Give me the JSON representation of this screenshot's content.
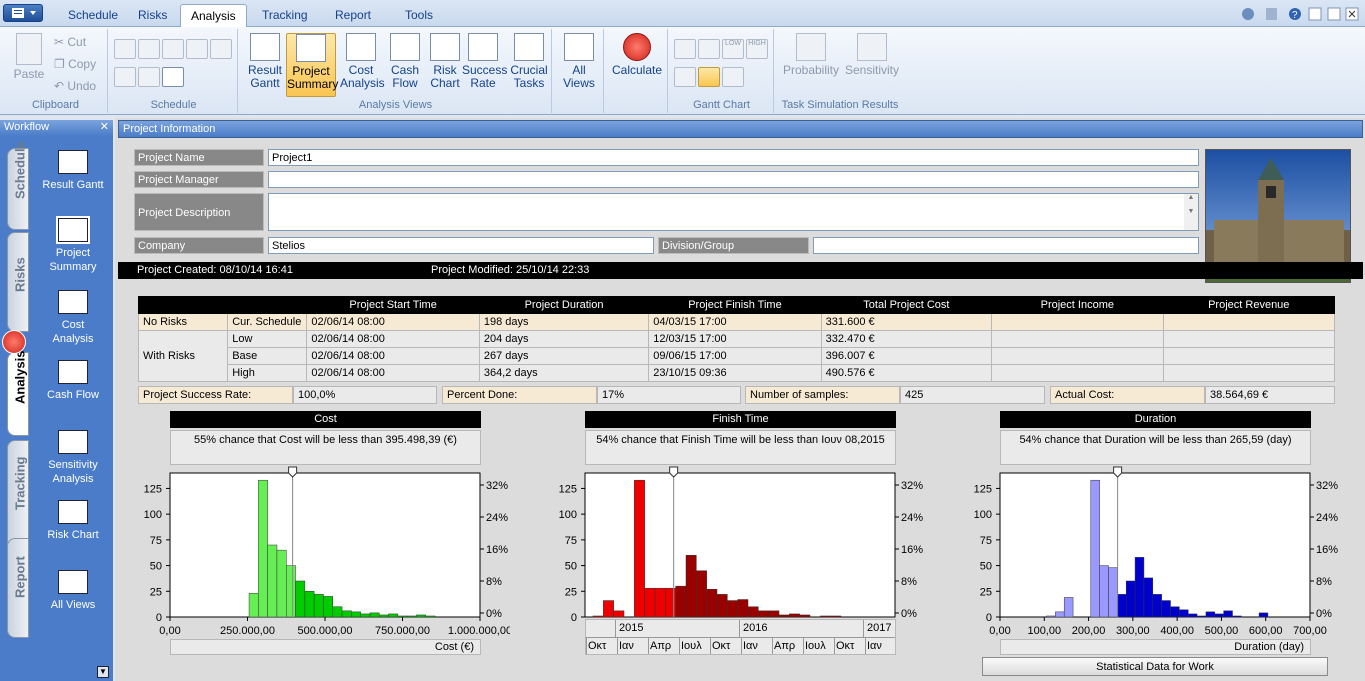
{
  "tabs": [
    {
      "label": "Schedule",
      "x": 58
    },
    {
      "label": "Risks",
      "x": 128
    },
    {
      "label": "Analysis",
      "x": 180,
      "active": true
    },
    {
      "label": "Tracking",
      "x": 252
    },
    {
      "label": "Report",
      "x": 325
    },
    {
      "label": "Tools",
      "x": 395
    }
  ],
  "ribbon": {
    "clipboard": {
      "paste": "Paste",
      "cut": "Cut",
      "copy": "Copy",
      "undo": "Undo",
      "label": "Clipboard"
    },
    "schedule_label": "Schedule",
    "analysis_views": {
      "label": "Analysis Views",
      "buttons": [
        {
          "l1": "Result",
          "l2": "Gantt"
        },
        {
          "l1": "Project",
          "l2": "Summary"
        },
        {
          "l1": "Cost",
          "l2": "Analysis"
        },
        {
          "l1": "Cash",
          "l2": "Flow"
        },
        {
          "l1": "Risk",
          "l2": "Chart"
        },
        {
          "l1": "Success",
          "l2": "Rate"
        },
        {
          "l1": "Crucial",
          "l2": "Tasks"
        }
      ]
    },
    "all_views": {
      "l1": "All",
      "l2": "Views"
    },
    "calculate": "Calculate",
    "gantt_chart_label": "Gantt Chart",
    "probability": "Probability",
    "sensitivity": "Sensitivity",
    "task_sim_label": "Task Simulation Results"
  },
  "workflow": {
    "title": "Workflow",
    "vtabs": [
      "Schedule",
      "Risks",
      "Analysis",
      "Tracking",
      "Report"
    ],
    "items": [
      {
        "l1": "Result Gantt",
        "l2": ""
      },
      {
        "l1": "Project",
        "l2": "Summary"
      },
      {
        "l1": "Cost",
        "l2": "Analysis"
      },
      {
        "l1": "Cash Flow",
        "l2": ""
      },
      {
        "l1": "Sensitivity",
        "l2": "Analysis"
      },
      {
        "l1": "Risk Chart",
        "l2": ""
      },
      {
        "l1": "All Views",
        "l2": ""
      }
    ]
  },
  "panel": {
    "title": "Project Information",
    "labels": {
      "name": "Project Name",
      "manager": "Project Manager",
      "description": "Project Description",
      "company": "Company",
      "division": "Division/Group"
    },
    "values": {
      "name": "Project1",
      "manager": "",
      "description": "",
      "company": "Stelios",
      "division": ""
    },
    "created": "Project Created: 08/10/14 16:41",
    "modified": "Project Modified: 25/10/14 22:33"
  },
  "summary": {
    "headers": [
      "",
      "",
      "Project Start Time",
      "Project Duration",
      "Project Finish Time",
      "Total Project Cost",
      "Project Income",
      "Project Revenue"
    ],
    "no_risks": "No Risks",
    "with_risks": "With Risks",
    "rows": [
      [
        "Cur. Schedule",
        "02/06/14 08:00",
        "198 days",
        "04/03/15 17:00",
        "331.600 €",
        "",
        ""
      ],
      [
        "Low",
        "02/06/14 08:00",
        "204 days",
        "12/03/15 17:00",
        "332.470 €",
        "",
        ""
      ],
      [
        "Base",
        "02/06/14 08:00",
        "267 days",
        "09/06/15 17:00",
        "396.007 €",
        "",
        ""
      ],
      [
        "High",
        "02/06/14 08:00",
        "364,2 days",
        "23/10/15 09:36",
        "490.576 €",
        "",
        ""
      ]
    ]
  },
  "stats": {
    "success_label": "Project Success Rate:",
    "success_value": "100,0%",
    "percent_label": "Percent Done:",
    "percent_value": "17%",
    "samples_label": "Number of samples:",
    "samples_value": "425",
    "actual_label": "Actual Cost:",
    "actual_value": "38.564,69 €"
  },
  "stat_button": "Statistical Data for Work",
  "chart_data": [
    {
      "type": "bar",
      "title": "Cost",
      "annotation": "55% chance that Cost will be less than 395.498,39 (€)",
      "xlabel": "Cost (€)",
      "xlim": [
        0,
        1000000
      ],
      "x_ticks": [
        "0,00",
        "250.000,00",
        "500.000,00",
        "750.000,00",
        "1.000.000,00"
      ],
      "ylim": [
        0,
        140
      ],
      "y_ticks": [
        "0",
        "25",
        "50",
        "75",
        "100",
        "125"
      ],
      "y2_ticks": [
        "0%",
        "8%",
        "16%",
        "24%",
        "32%"
      ],
      "marker": 395498,
      "color": "#66ee55",
      "dark_color": "#00cc00",
      "bins_x": [
        270000,
        300000,
        330000,
        360000,
        390000,
        420000,
        450000,
        480000,
        510000,
        540000,
        570000,
        600000,
        630000,
        660000,
        690000,
        720000,
        750000,
        780000,
        810000,
        840000
      ],
      "bins_v": [
        23,
        133,
        70,
        65,
        50,
        35,
        25,
        22,
        20,
        10,
        6,
        5,
        3,
        4,
        2,
        3,
        1,
        1,
        2,
        1
      ]
    },
    {
      "type": "bar",
      "title": "Finish Time",
      "annotation": "54% chance that Finish Time will be less than Ιουν 08,2015",
      "xlabel": "",
      "year_labels": [
        "2015",
        "2016",
        "2017"
      ],
      "month_labels": [
        "Οκτ",
        "Ιαν",
        "Απρ",
        "Ιουλ",
        "Οκτ",
        "Ιαν",
        "Απρ",
        "Ιουλ",
        "Οκτ",
        "Ιαν"
      ],
      "ylim": [
        0,
        140
      ],
      "y_ticks": [
        "0",
        "25",
        "50",
        "75",
        "100",
        "125"
      ],
      "y2_ticks": [
        "0%",
        "8%",
        "16%",
        "24%",
        "32%"
      ],
      "color": "#ee0000",
      "dark_color": "#990000",
      "bins_v": [
        1,
        16,
        6,
        0,
        133,
        28,
        28,
        28,
        30,
        60,
        45,
        27,
        22,
        16,
        17,
        10,
        6,
        6,
        2,
        3,
        2,
        0,
        1,
        1
      ],
      "marker_bin": 8
    },
    {
      "type": "bar",
      "title": "Duration",
      "annotation": "54% chance that Duration will be less than 265,59 (day)",
      "xlabel": "Duration (day)",
      "xlim": [
        0,
        700
      ],
      "x_ticks": [
        "0,00",
        "100,00",
        "200,00",
        "300,00",
        "400,00",
        "500,00",
        "600,00",
        "700,00"
      ],
      "ylim": [
        0,
        140
      ],
      "y_ticks": [
        "0",
        "25",
        "50",
        "75",
        "100",
        "125"
      ],
      "y2_ticks": [
        "0%",
        "8%",
        "16%",
        "24%",
        "32%"
      ],
      "marker": 265.59,
      "color": "#9999ff",
      "dark_color": "#0000cc",
      "bins_x": [
        115,
        135,
        155,
        175,
        195,
        215,
        235,
        255,
        275,
        295,
        315,
        335,
        355,
        375,
        395,
        415,
        435,
        455,
        475,
        495,
        515,
        535,
        555,
        575,
        595
      ],
      "bins_v": [
        1,
        5,
        19,
        0,
        0,
        133,
        50,
        48,
        22,
        35,
        58,
        38,
        22,
        16,
        10,
        7,
        3,
        1,
        5,
        3,
        6,
        1,
        0,
        0,
        4
      ]
    }
  ]
}
